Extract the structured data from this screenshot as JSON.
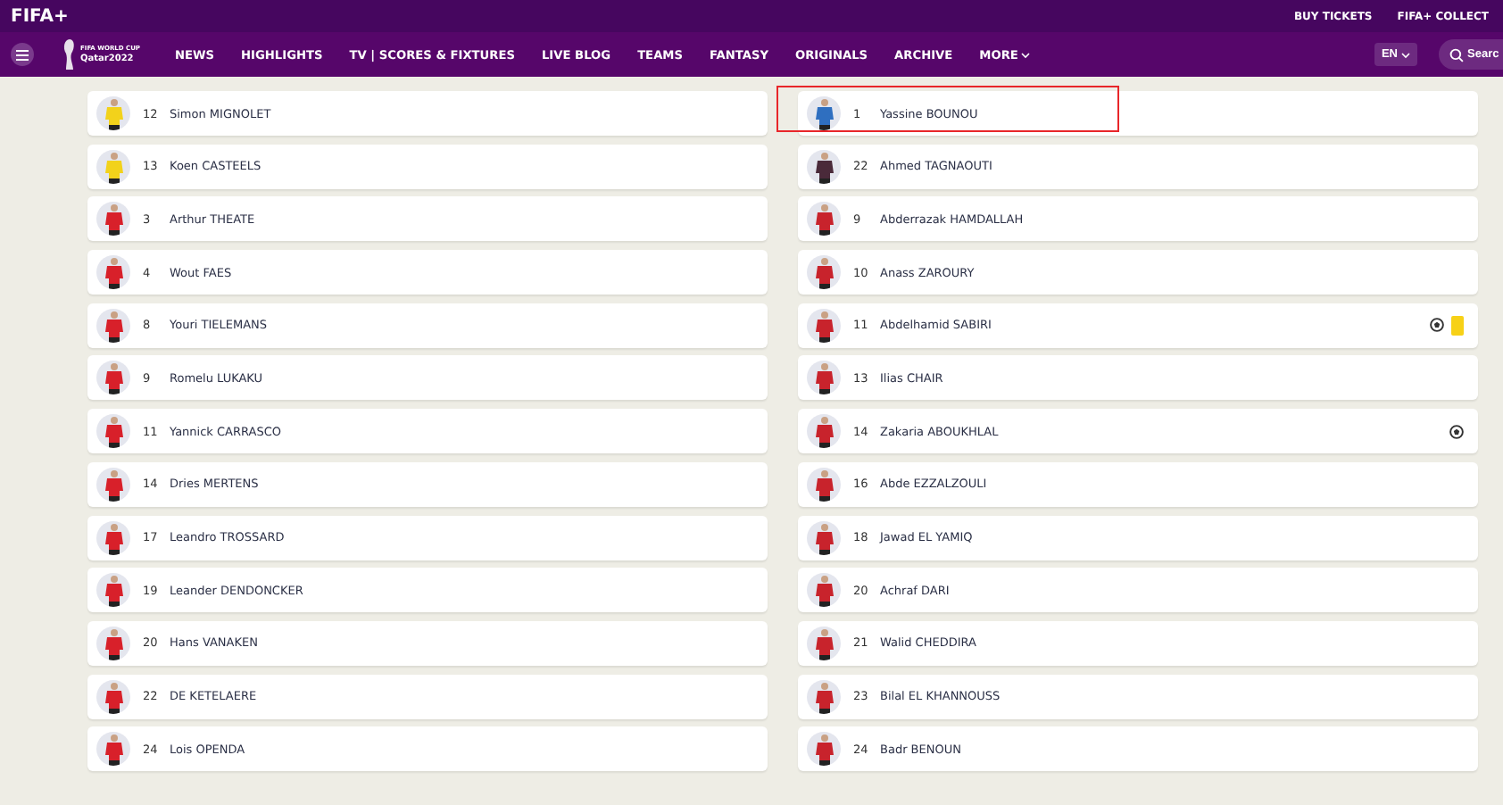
{
  "top_bar": {
    "logo": "FIFA+",
    "links": [
      "BUY TICKETS",
      "FIFA+ COLLECT"
    ]
  },
  "nav": {
    "logo_lines": [
      "FIFA WORLD CUP",
      "Qatar2022"
    ],
    "items": [
      {
        "label": "NEWS",
        "dropdown": false
      },
      {
        "label": "HIGHLIGHTS",
        "dropdown": false
      },
      {
        "label": "TV | SCORES & FIXTURES",
        "dropdown": false
      },
      {
        "label": "LIVE BLOG",
        "dropdown": false
      },
      {
        "label": "TEAMS",
        "dropdown": false
      },
      {
        "label": "FANTASY",
        "dropdown": false
      },
      {
        "label": "ORIGINALS",
        "dropdown": false
      },
      {
        "label": "ARCHIVE",
        "dropdown": false
      },
      {
        "label": "MORE",
        "dropdown": true
      }
    ],
    "language": "EN",
    "search": {
      "placeholder": "Searc"
    }
  },
  "lineups": [
    {
      "players": [
        {
          "number": "12",
          "name": "Simon MIGNOLET",
          "color": "#f2d21b",
          "highlighted": false
        },
        {
          "number": "13",
          "name": "Koen CASTEELS",
          "color": "#f2d21b",
          "highlighted": false
        },
        {
          "number": "3",
          "name": "Arthur THEATE",
          "color": "#d8202a",
          "highlighted": false
        },
        {
          "number": "4",
          "name": "Wout FAES",
          "color": "#d8202a",
          "highlighted": false
        },
        {
          "number": "8",
          "name": "Youri TIELEMANS",
          "color": "#d8202a",
          "highlighted": false
        },
        {
          "number": "9",
          "name": "Romelu LUKAKU",
          "color": "#d8202a",
          "highlighted": false
        },
        {
          "number": "11",
          "name": "Yannick CARRASCO",
          "color": "#d8202a",
          "highlighted": false
        },
        {
          "number": "14",
          "name": "Dries MERTENS",
          "color": "#d8202a",
          "highlighted": false
        },
        {
          "number": "17",
          "name": "Leandro TROSSARD",
          "color": "#d8202a",
          "highlighted": false
        },
        {
          "number": "19",
          "name": "Leander DENDONCKER",
          "color": "#d8202a",
          "highlighted": false
        },
        {
          "number": "20",
          "name": "Hans VANAKEN",
          "color": "#d8202a",
          "highlighted": false
        },
        {
          "number": "22",
          "name": "DE KETELAERE",
          "color": "#d8202a",
          "highlighted": false
        },
        {
          "number": "24",
          "name": "Lois OPENDA",
          "color": "#d8202a",
          "highlighted": false
        }
      ]
    },
    {
      "players": [
        {
          "number": "1",
          "name": "Yassine BOUNOU",
          "color": "#2f6fc0",
          "highlighted": true
        },
        {
          "number": "22",
          "name": "Ahmed TAGNAOUTI",
          "color": "#4a2a3a",
          "highlighted": false
        },
        {
          "number": "9",
          "name": "Abderrazak HAMDALLAH",
          "color": "#c8232c",
          "highlighted": false
        },
        {
          "number": "10",
          "name": "Anass ZAROURY",
          "color": "#c8232c",
          "highlighted": false
        },
        {
          "number": "11",
          "name": "Abdelhamid SABIRI",
          "color": "#c8232c",
          "highlighted": false,
          "events": [
            {
              "kind": "goal"
            },
            {
              "kind": "yellow_card"
            }
          ]
        },
        {
          "number": "13",
          "name": "Ilias CHAIR",
          "color": "#c8232c",
          "highlighted": false
        },
        {
          "number": "14",
          "name": "Zakaria ABOUKHLAL",
          "color": "#c8232c",
          "highlighted": false,
          "events": [
            {
              "kind": "goal"
            }
          ]
        },
        {
          "number": "16",
          "name": "Abde EZZALZOULI",
          "color": "#c8232c",
          "highlighted": false
        },
        {
          "number": "18",
          "name": "Jawad EL YAMIQ",
          "color": "#c8232c",
          "highlighted": false
        },
        {
          "number": "20",
          "name": "Achraf DARI",
          "color": "#c8232c",
          "highlighted": false
        },
        {
          "number": "21",
          "name": "Walid CHEDDIRA",
          "color": "#c8232c",
          "highlighted": false
        },
        {
          "number": "23",
          "name": "Bilal EL KHANNOUSS",
          "color": "#c8232c",
          "highlighted": false
        },
        {
          "number": "24",
          "name": "Badr BENOUN",
          "color": "#c8232c",
          "highlighted": false
        }
      ]
    }
  ]
}
